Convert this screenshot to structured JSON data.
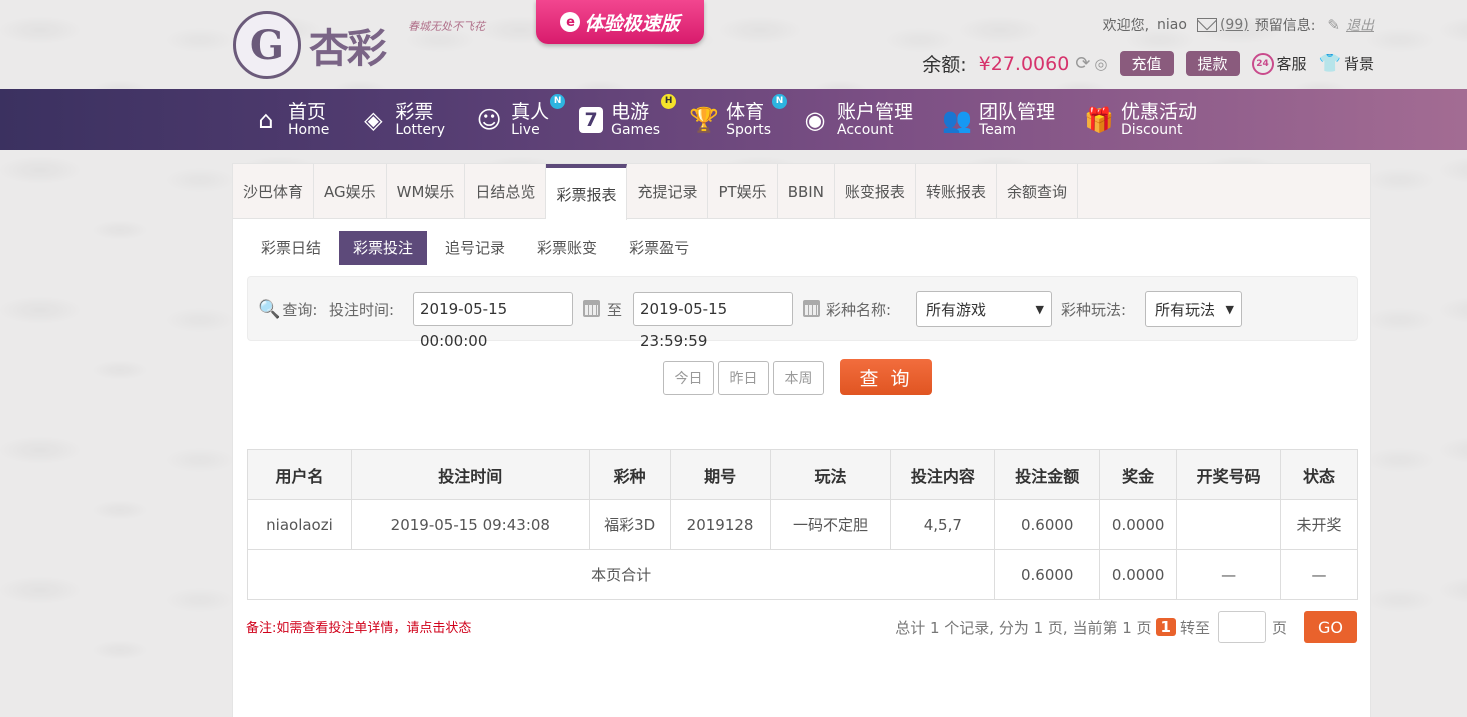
{
  "header": {
    "brand": "杏彩",
    "slogan": "春城无处不飞花",
    "promo_label": "体验极速版",
    "welcome": "欢迎您,",
    "username": "niao",
    "mail_count": "(99)",
    "reserve_label": "预留信息:",
    "logout_label": "退出",
    "balance_label": "余额:",
    "balance_value": "¥27.0060",
    "deposit_label": "充值",
    "withdraw_label": "提款",
    "service_label": "客服",
    "background_label": "背景"
  },
  "nav": [
    {
      "cn": "首页",
      "en": "Home"
    },
    {
      "cn": "彩票",
      "en": "Lottery"
    },
    {
      "cn": "真人",
      "en": "Live",
      "badge": "N"
    },
    {
      "cn": "电游",
      "en": "Games",
      "badge": "H"
    },
    {
      "cn": "体育",
      "en": "Sports",
      "badge": "N"
    },
    {
      "cn": "账户管理",
      "en": "Account"
    },
    {
      "cn": "团队管理",
      "en": "Team"
    },
    {
      "cn": "优惠活动",
      "en": "Discount"
    }
  ],
  "tabs": [
    "沙巴体育",
    "AG娱乐",
    "WM娱乐",
    "日结总览",
    "彩票报表",
    "充提记录",
    "PT娱乐",
    "BBIN",
    "账变报表",
    "转账报表",
    "余额查询"
  ],
  "subtabs": [
    "彩票日结",
    "彩票投注",
    "追号记录",
    "彩票账变",
    "彩票盈亏"
  ],
  "search": {
    "query_label": "查询:",
    "time_label": "投注时间:",
    "start": "2019-05-15 00:00:00",
    "to_label": "至",
    "end": "2019-05-15 23:59:59",
    "game_label": "彩种名称:",
    "game_value": "所有游戏",
    "play_label": "彩种玩法:",
    "play_value": "所有玩法",
    "today": "今日",
    "yesterday": "昨日",
    "week": "本周",
    "submit": "查 询"
  },
  "table": {
    "headers": [
      "用户名",
      "投注时间",
      "彩种",
      "期号",
      "玩法",
      "投注内容",
      "投注金额",
      "奖金",
      "开奖号码",
      "状态"
    ],
    "rows": [
      [
        "niaolaozi",
        "2019-05-15 09:43:08",
        "福彩3D",
        "2019128",
        "一码不定胆",
        "4,5,7",
        "0.6000",
        "0.0000",
        "",
        "未开奖"
      ]
    ],
    "total_label": "本页合计",
    "total_amount": "0.6000",
    "total_prize": "0.0000",
    "total_dash1": "—",
    "total_dash2": "—"
  },
  "footer": {
    "note": "备注:如需查看投注单详情，请点击状态",
    "pager_text": "总计 1 个记录, 分为 1 页, 当前第 1 页",
    "current_page": "1",
    "goto_label": "转至",
    "page_unit": "页",
    "go": "GO"
  }
}
